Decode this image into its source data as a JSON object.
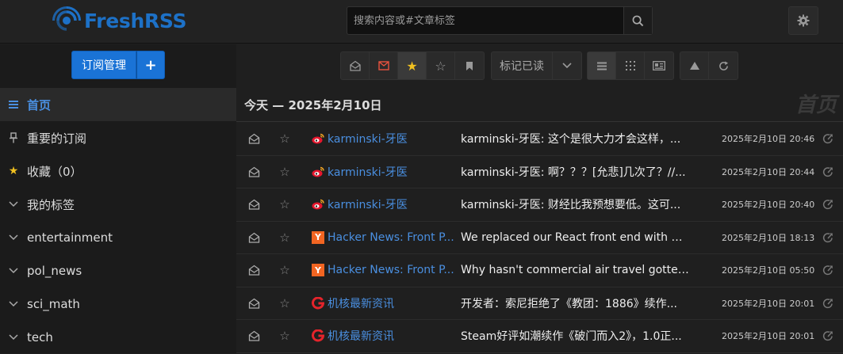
{
  "app": {
    "name": "FreshRSS"
  },
  "search": {
    "placeholder": "搜索内容或#文章标签"
  },
  "sidebar": {
    "subscription_button": "订阅管理",
    "add_button": "+",
    "items": [
      {
        "label": "首页",
        "icon": "list-icon",
        "active": true
      },
      {
        "label": "重要的订阅",
        "icon": "pin-icon",
        "active": false
      },
      {
        "label": "收藏（0）",
        "icon": "star-icon",
        "active": false
      },
      {
        "label": "我的标签",
        "icon": "chevron-down-icon",
        "active": false
      },
      {
        "label": "entertainment",
        "icon": "chevron-down-icon",
        "active": false
      },
      {
        "label": "pol_news",
        "icon": "chevron-down-icon",
        "active": false
      },
      {
        "label": "sci_math",
        "icon": "chevron-down-icon",
        "active": false
      },
      {
        "label": "tech",
        "icon": "chevron-down-icon",
        "active": false
      }
    ]
  },
  "toolbar": {
    "mark_read_label": "标记已读"
  },
  "day": {
    "header": "今天 — 2025年2月10日",
    "watermark": "首页"
  },
  "articles": [
    {
      "feed": "karminski-牙医",
      "favicon": "weibo-icon",
      "title": "karminski-牙医: 这个是很大力才会这样，...",
      "date": "2025年2月10日 20:46"
    },
    {
      "feed": "karminski-牙医",
      "favicon": "weibo-icon",
      "title": "karminski-牙医: 啊？？？[允悲]几次了？//...",
      "date": "2025年2月10日 20:44"
    },
    {
      "feed": "karminski-牙医",
      "favicon": "weibo-icon",
      "title": "karminski-牙医: 财经比我预想要低。这可...",
      "date": "2025年2月10日 20:40"
    },
    {
      "feed": "Hacker News: Front P...",
      "favicon": "hackernews-icon",
      "favicon_letter": "Y",
      "title": "We replaced our React front end with Go...",
      "date": "2025年2月10日 18:13"
    },
    {
      "feed": "Hacker News: Front P...",
      "favicon": "hackernews-icon",
      "favicon_letter": "Y",
      "title": "Why hasn't commercial air travel gotten ...",
      "date": "2025年2月10日 05:50"
    },
    {
      "feed": "机核最新资讯",
      "favicon": "gcores-icon",
      "title": "开发者：索尼拒绝了《教团：1886》续作...",
      "date": "2025年2月10日 20:01"
    },
    {
      "feed": "机核最新资讯",
      "favicon": "gcores-icon",
      "title": "Steam好评如潮续作《破门而入2》，1.0正...",
      "date": "2025年2月10日 20:01"
    }
  ],
  "colors": {
    "accent": "#1a73d6",
    "link": "#4a8fe0",
    "brand": "#1d71c7"
  }
}
